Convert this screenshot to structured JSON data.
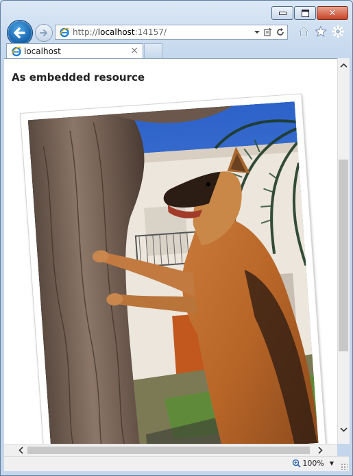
{
  "window": {
    "minimize_label": "minimize",
    "maximize_label": "maximize",
    "close_label": "close"
  },
  "address_bar": {
    "url_prefix": "http://",
    "url_host": "localhost",
    "url_rest": ":14157/"
  },
  "tabs": [
    {
      "label": "localhost",
      "active": true
    }
  ],
  "tab_close_glyph": "×",
  "page": {
    "heading": "As embedded resource"
  },
  "image": {
    "subject": "German shepherd dog standing on hind legs against a tree trunk",
    "rotation_deg": -4
  },
  "status_bar": {
    "zoom": "100%"
  },
  "icons": {
    "back": "back-arrow-icon",
    "forward": "forward-arrow-icon",
    "site": "ie-page-icon",
    "search_dropdown": "chevron-down-icon",
    "compatibility": "compatibility-view-icon",
    "refresh": "refresh-icon",
    "home": "home-icon",
    "favorites": "star-icon",
    "tools": "gear-icon",
    "zoom": "zoom-icon"
  },
  "colors": {
    "chrome_blue": "#c3d6ec",
    "back_button": "#1a6fbf",
    "close_button": "#c74427",
    "content_bg": "#ffffff"
  }
}
